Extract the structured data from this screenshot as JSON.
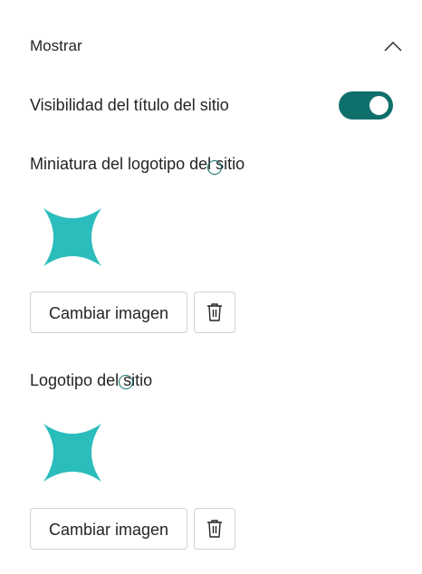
{
  "section": {
    "title": "Mostrar",
    "icon": "chevron-up-icon"
  },
  "site_title_visibility": {
    "label": "Visibilidad del título del sitio",
    "enabled": true,
    "toggle_color": "#0f6f6b"
  },
  "logo_thumbnail": {
    "label": "Miniatura del logotipo del sitio",
    "image_icon": "four-point-star-logo",
    "logo_color": "#2bbcbc",
    "change_button": "Cambiar imagen",
    "delete_icon": "trash-icon"
  },
  "site_logo": {
    "label": "Logotipo del sitio",
    "image_icon": "four-point-star-logo",
    "logo_color": "#2bbcbc",
    "change_button": "Cambiar imagen",
    "delete_icon": "trash-icon"
  }
}
